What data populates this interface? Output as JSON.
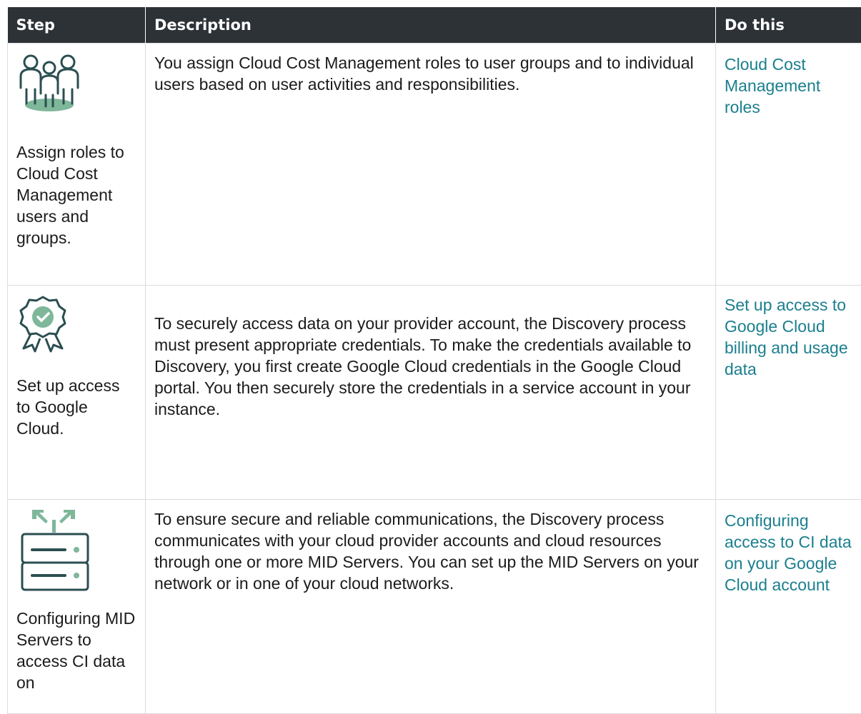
{
  "headers": {
    "step": "Step",
    "description": "Description",
    "do_this": "Do this"
  },
  "rows": [
    {
      "icon": "users-group-icon",
      "step": "Assign roles to Cloud Cost Management users and groups.",
      "description": "You assign Cloud Cost Management roles to user groups and to individual users based on user activities and responsibilities.",
      "link": "Cloud Cost Management roles"
    },
    {
      "icon": "certificate-badge-icon",
      "step": "Set up access to Google Cloud.",
      "description": "To securely access data on your provider account, the Discovery process must present appropriate credentials. To make the credentials available to Discovery, you first create Google Cloud credentials in the Google Cloud portal. You then securely store the credentials in a service account in your instance.",
      "link": "Set up access to Google Cloud billing and usage data"
    },
    {
      "icon": "server-network-icon",
      "step": "Configuring MID Servers to access CI data on",
      "description": "To ensure secure and reliable communications, the Discovery process communicates with your cloud provider accounts and cloud resources through one or more MID Servers. You can set up the MID Servers on your network or in one of your cloud networks.",
      "link": "Configuring access to CI data on your Google Cloud account"
    }
  ],
  "colors": {
    "header_bg": "#2d3237",
    "link": "#1b7f8e",
    "icon_green": "#7fb79b",
    "icon_dark": "#2b4e51"
  }
}
